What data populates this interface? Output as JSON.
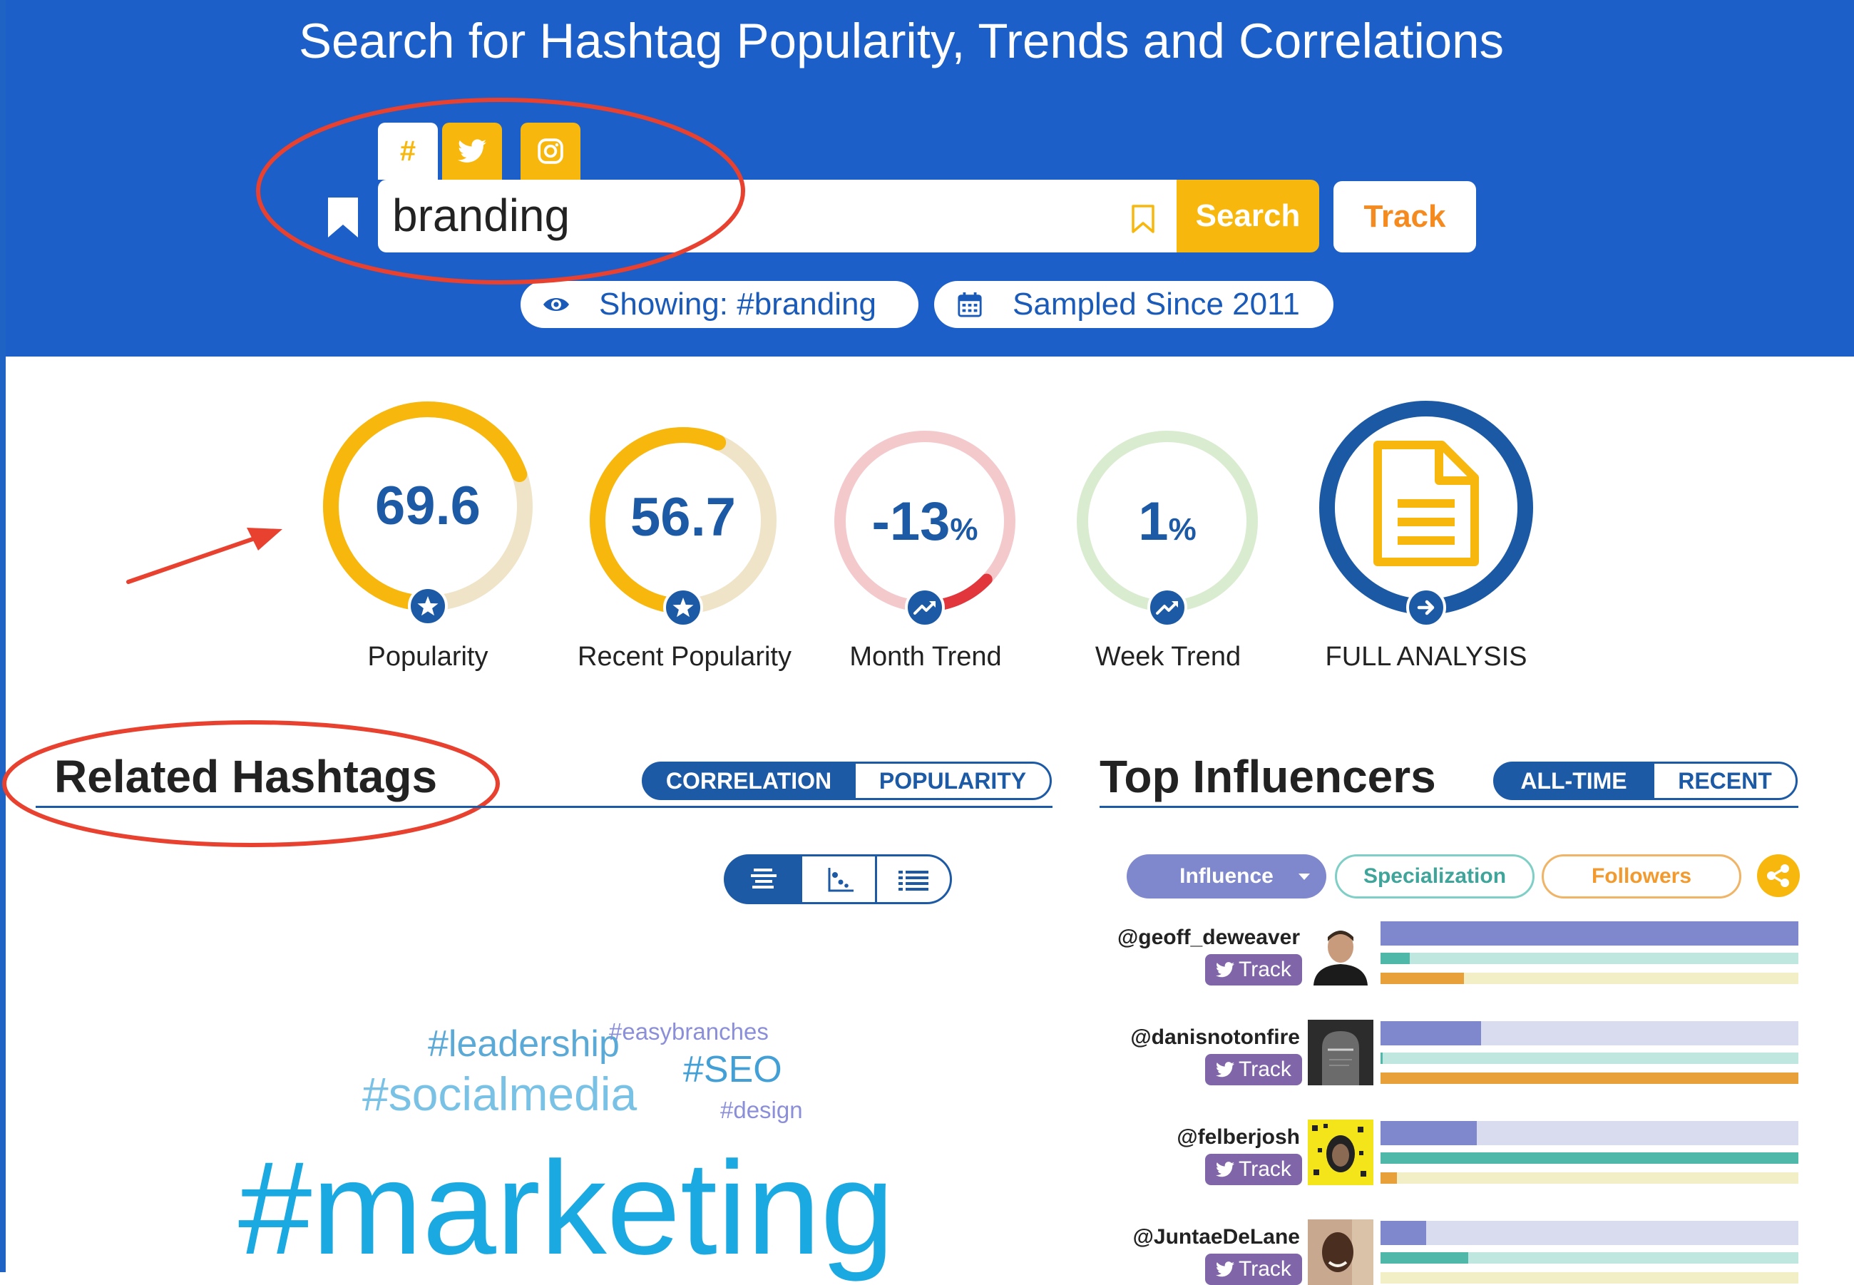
{
  "header": {
    "title": "Search for Hashtag Popularity, Trends and Correlations",
    "network_tabs": [
      {
        "name": "hashtag",
        "icon": "hash-icon",
        "glyph": "#"
      },
      {
        "name": "twitter",
        "icon": "twitter-icon"
      },
      {
        "name": "instagram",
        "icon": "instagram-icon"
      }
    ]
  },
  "search": {
    "value": "branding",
    "search_label": "Search",
    "track_label": "Track"
  },
  "status": {
    "showing": "Showing: #branding",
    "sampled": "Sampled Since 2011"
  },
  "metrics": [
    {
      "value": "69.6",
      "unit": "",
      "label": "Popularity",
      "fill": 0.696,
      "color": "#f7b70c",
      "track": "#efe4c8",
      "badge": "star-icon"
    },
    {
      "value": "56.7",
      "unit": "",
      "label": "Recent Popularity",
      "fill": 0.567,
      "color": "#f7b70c",
      "track": "#efe4c8",
      "badge": "star-icon"
    },
    {
      "value": "-13",
      "unit": "%",
      "label": "Month Trend",
      "fill": 0.13,
      "color": "#e2363d",
      "track": "#f3c9cc",
      "badge": "trend-up-icon"
    },
    {
      "value": "1",
      "unit": "%",
      "label": "Week Trend",
      "fill": 0.01,
      "color": "#d9ecd0",
      "track": "#d9ecd0",
      "badge": "trend-up-icon"
    }
  ],
  "full_analysis": {
    "label": "FULL ANALYSIS",
    "ring_color": "#1c59a4",
    "icon_color": "#f7b70c"
  },
  "related": {
    "title": "Related Hashtags",
    "toggle": [
      "CORRELATION",
      "POPULARITY"
    ],
    "active_toggle": "CORRELATION",
    "view_modes": [
      "cloud-view-icon",
      "scatter-view-icon",
      "list-view-icon"
    ],
    "active_view": "cloud-view-icon",
    "words": {
      "leadership": "#leadership",
      "easybranches": "#easybranches",
      "socialmedia": "#socialmedia",
      "seo": "#SEO",
      "design": "#design",
      "marketing": "#marketing"
    }
  },
  "influencers": {
    "title": "Top Influencers",
    "toggle": [
      "ALL-TIME",
      "RECENT"
    ],
    "active_toggle": "ALL-TIME",
    "sort_options": [
      "Influence",
      "Specialization",
      "Followers"
    ],
    "active_sort": "Influence",
    "track_label": "Track",
    "bar_colors": {
      "influence": "#7f88cc",
      "influence_bg": "#d8dcee",
      "specialization": "#4fb8a8",
      "specialization_bg": "#bfe6df",
      "followers": "#e8a13a",
      "followers_bg": "#f2efc6"
    },
    "list": [
      {
        "handle": "@geoff_deweaver",
        "influence": 1.0,
        "specialization": 0.07,
        "followers": 0.2
      },
      {
        "handle": "@danisnotonfire",
        "influence": 0.24,
        "specialization": 0.005,
        "followers": 1.0
      },
      {
        "handle": "@felberjosh",
        "influence": 0.23,
        "specialization": 1.0,
        "followers": 0.04
      },
      {
        "handle": "@JuntaeDeLane",
        "influence": 0.11,
        "specialization": 0.21,
        "followers": 0.0
      }
    ]
  }
}
